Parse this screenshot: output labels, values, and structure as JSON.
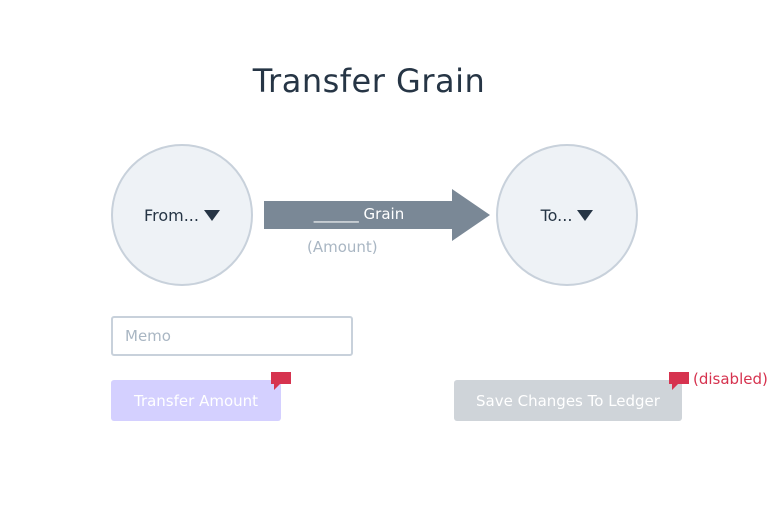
{
  "title": "Transfer Grain",
  "from": {
    "label": "From...",
    "icon": "caret-down-icon"
  },
  "to": {
    "label": "To...",
    "icon": "caret-down-icon"
  },
  "amount": {
    "field_label": "______ Grain",
    "hint": "(Amount)"
  },
  "memo": {
    "placeholder": "Memo",
    "value": ""
  },
  "buttons": {
    "transfer": "Transfer Amount",
    "save": "Save Changes To Ledger"
  },
  "annotations": {
    "disabled_note": "(disabled)",
    "comment_icon": "comment-icon"
  },
  "colors": {
    "title": "#263545",
    "arrow": "#7a8896",
    "circle_fill": "#eef2f6",
    "circle_border": "#c8d1db",
    "transfer_button": "#d4d0ff",
    "save_button": "#cfd4d9",
    "annotation": "#d6334f"
  }
}
